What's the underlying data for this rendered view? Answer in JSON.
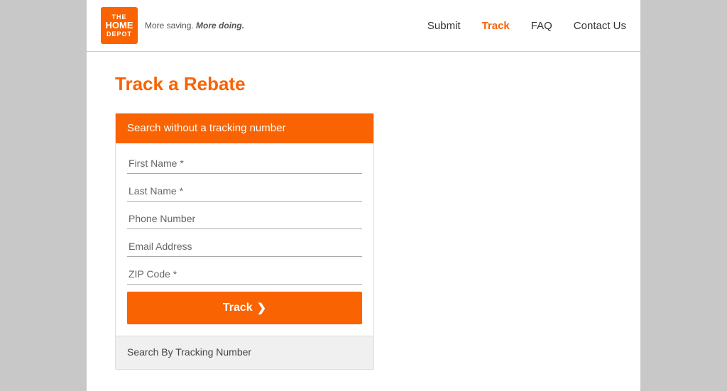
{
  "header": {
    "logo": {
      "line1": "THE",
      "line2": "HOME",
      "line3": "DEPOT",
      "slogan": "More saving. More doing."
    },
    "nav": [
      {
        "id": "submit",
        "label": "Submit",
        "active": false
      },
      {
        "id": "track",
        "label": "Track",
        "active": true
      },
      {
        "id": "faq",
        "label": "FAQ",
        "active": false
      },
      {
        "id": "contact-us",
        "label": "Contact Us",
        "active": false
      }
    ]
  },
  "main": {
    "page_title": "Track a Rebate",
    "form_card": {
      "header": "Search without a tracking number",
      "fields": [
        {
          "id": "first-name",
          "placeholder": "First Name *"
        },
        {
          "id": "last-name",
          "placeholder": "Last Name *"
        },
        {
          "id": "phone-number",
          "placeholder": "Phone Number"
        },
        {
          "id": "email-address",
          "placeholder": "Email Address"
        },
        {
          "id": "zip-code",
          "placeholder": "ZIP Code *"
        }
      ],
      "track_button_label": "Track",
      "track_button_chevron": "❯",
      "footer_text": "Search By Tracking Number"
    }
  }
}
